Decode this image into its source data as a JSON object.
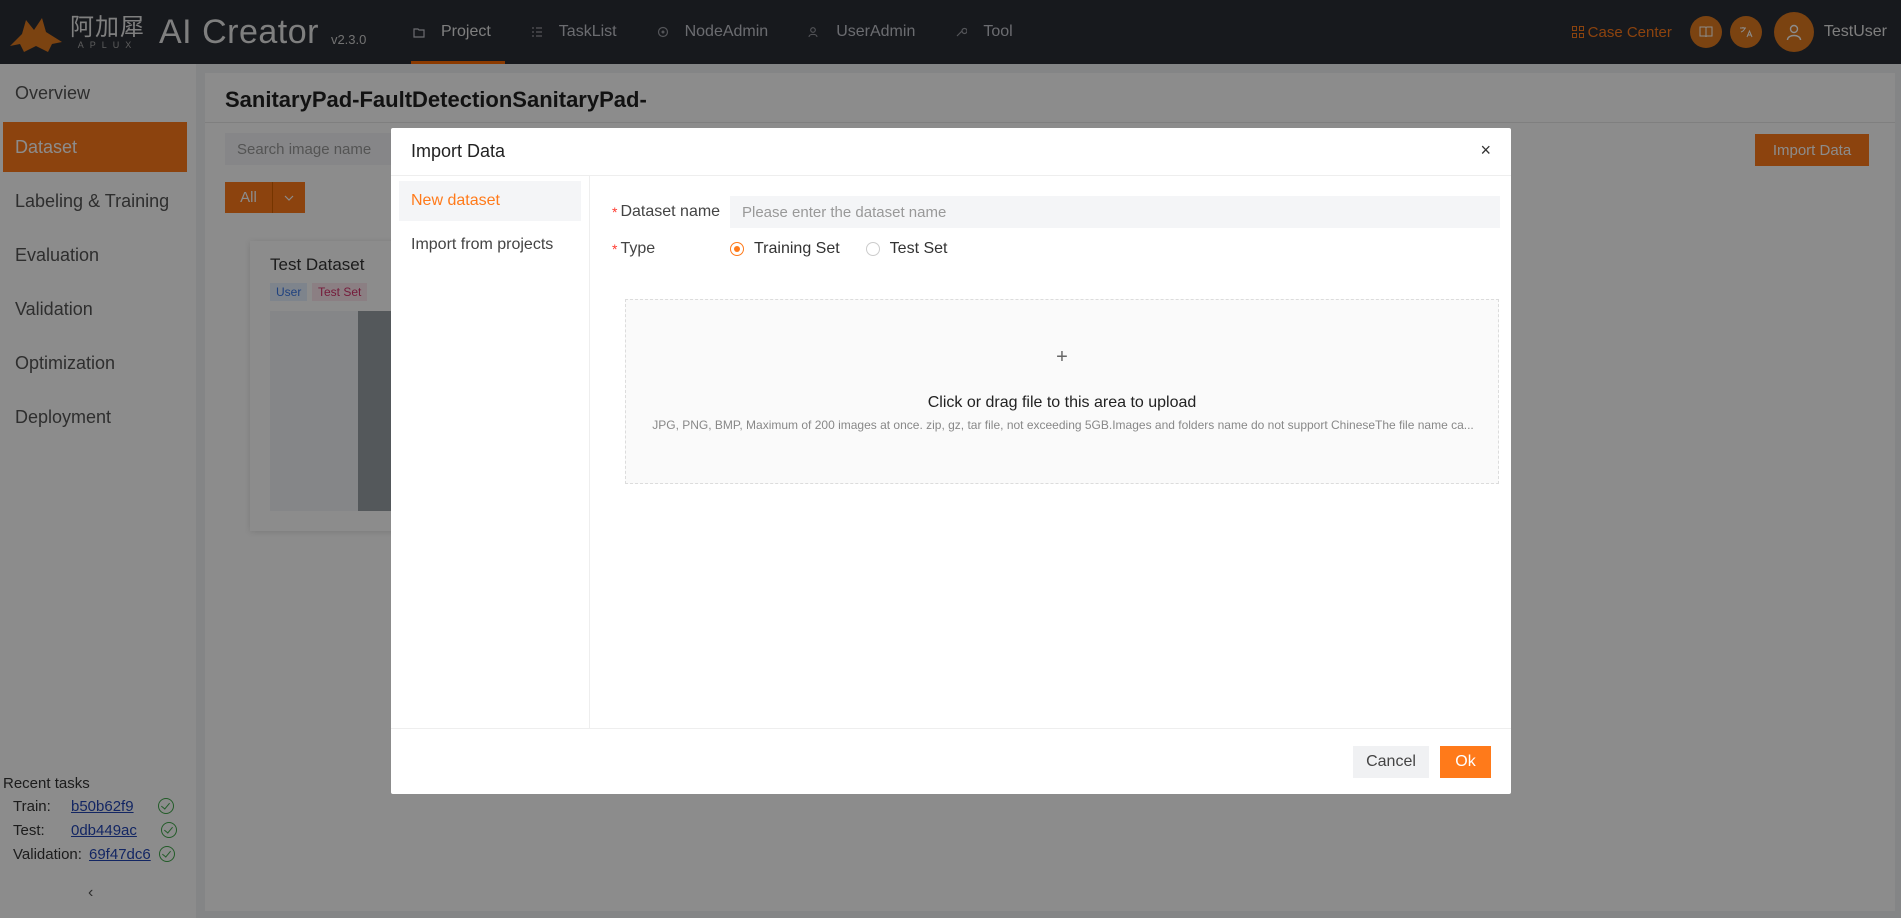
{
  "app": {
    "brand_cn": "阿加犀",
    "brand_en": "APLUX",
    "name": "AI Creator",
    "version": "v2.3.0"
  },
  "nav": {
    "items": [
      {
        "label": "Project",
        "icon": "folder-icon",
        "active": true
      },
      {
        "label": "TaskList",
        "icon": "list-icon"
      },
      {
        "label": "NodeAdmin",
        "icon": "node-icon"
      },
      {
        "label": "UserAdmin",
        "icon": "users-icon"
      },
      {
        "label": "Tool",
        "icon": "wrench-icon"
      }
    ],
    "case_center": "Case Center",
    "username": "TestUser"
  },
  "sidebar": {
    "items": [
      {
        "label": "Overview"
      },
      {
        "label": "Dataset",
        "active": true
      },
      {
        "label": "Labeling & Training"
      },
      {
        "label": "Evaluation"
      },
      {
        "label": "Validation"
      },
      {
        "label": "Optimization"
      },
      {
        "label": "Deployment"
      }
    ],
    "recent": {
      "title": "Recent tasks",
      "tasks": [
        {
          "label": "Train:",
          "id": "b50b62f9"
        },
        {
          "label": "Test:",
          "id": "0db449ac"
        },
        {
          "label": "Validation:",
          "id": "69f47dc6"
        }
      ]
    },
    "collapse": "‹"
  },
  "main": {
    "title": "SanitaryPad-FaultDetectionSanitaryPad-",
    "search_placeholder": "Search image name",
    "import_label": "Import Data",
    "filter_label": "All",
    "card": {
      "title": "Test Dataset",
      "tags": [
        "User",
        "Test Set"
      ]
    }
  },
  "modal": {
    "title": "Import Data",
    "close": "×",
    "tabs": [
      "New dataset",
      "Import from projects"
    ],
    "form": {
      "name_label": "Dataset name",
      "name_placeholder": "Please enter the dataset name",
      "type_label": "Type",
      "type_options": [
        "Training Set",
        "Test Set"
      ],
      "type_selected": "Training Set"
    },
    "upload": {
      "plus": "+",
      "title": "Click or drag file to this area to upload",
      "hint": "JPG, PNG, BMP, Maximum of 200 images at once. zip, gz, tar file, not exceeding 5GB.Images and folders name do not support ChineseThe file name ca..."
    },
    "cancel_label": "Cancel",
    "ok_label": "Ok"
  },
  "colors": {
    "accent": "#ff7a1a",
    "topbar": "#2b2e36"
  }
}
